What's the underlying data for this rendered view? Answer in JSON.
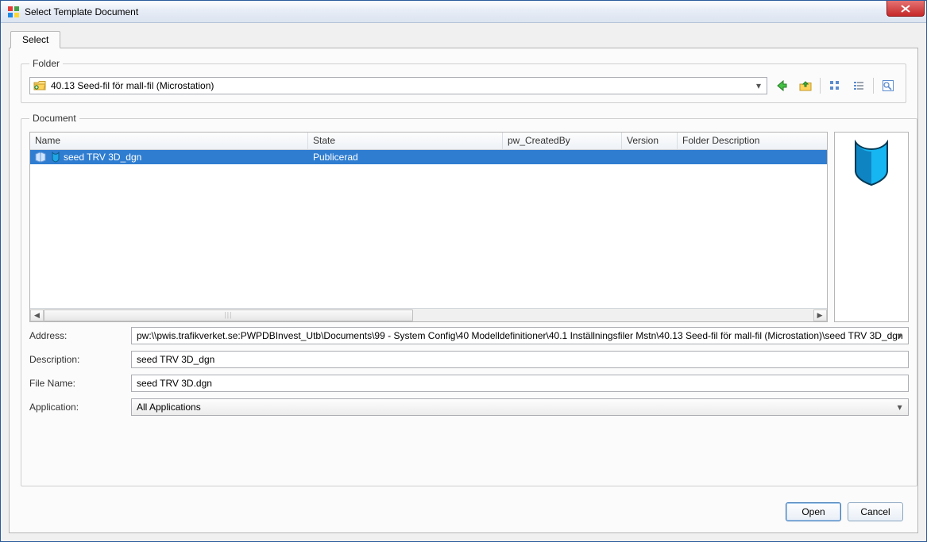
{
  "window": {
    "title": "Select Template Document"
  },
  "tab": {
    "label": "Select"
  },
  "folder_group": {
    "legend": "Folder",
    "selected": "40.13 Seed-fil för mall-fil (Microstation)"
  },
  "document_group": {
    "legend": "Document",
    "columns": {
      "name": "Name",
      "state": "State",
      "pw_createdby": "pw_CreatedBy",
      "version": "Version",
      "folder_description": "Folder Description"
    },
    "rows": [
      {
        "name": "seed TRV 3D_dgn",
        "state": "Publicerad",
        "pw_createdby": "",
        "version": "",
        "folder_description": ""
      }
    ]
  },
  "fields": {
    "address_label": "Address:",
    "address_value": "pw:\\\\pwis.trafikverket.se:PWPDBInvest_Utb\\Documents\\99 - System Config\\40 Modelldefinitioner\\40.1 Inställningsfiler Mstn\\40.13 Seed-fil för mall-fil (Microstation)\\seed TRV 3D_dgn",
    "description_label": "Description:",
    "description_value": "seed TRV 3D_dgn",
    "filename_label": "File Name:",
    "filename_value": "seed TRV 3D.dgn",
    "application_label": "Application:",
    "application_value": "All Applications"
  },
  "buttons": {
    "open": "Open",
    "cancel": "Cancel"
  }
}
